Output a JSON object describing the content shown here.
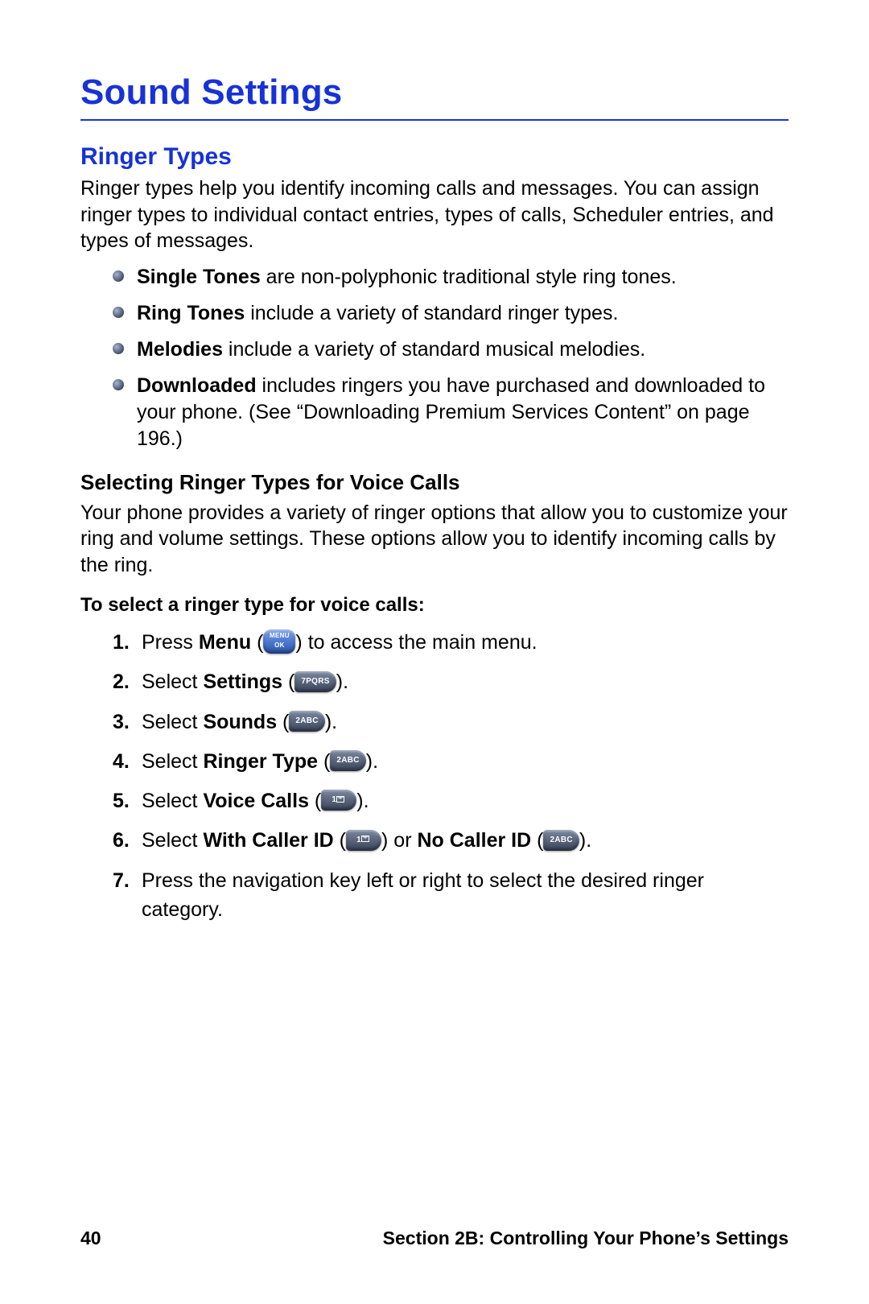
{
  "page_title": "Sound Settings",
  "subhead": "Ringer Types",
  "intro": "Ringer types help you identify incoming calls and messages. You can assign ringer types to individual contact entries, types of calls, Scheduler entries, and types of messages.",
  "bullets": [
    {
      "term": "Single Tones",
      "rest": " are non-polyphonic traditional style ring tones."
    },
    {
      "term": "Ring Tones",
      "rest": " include a variety of standard ringer types."
    },
    {
      "term": "Melodies",
      "rest": " include a variety of standard musical melodies."
    },
    {
      "term": "Downloaded",
      "rest": " includes ringers you have purchased and downloaded to your phone. (See “Downloading Premium Services Content” on page 196.)"
    }
  ],
  "subsub": "Selecting Ringer Types for Voice Calls",
  "subsub_intro": "Your phone provides a variety of ringer options that allow you to customize your ring and volume settings. These options allow you to identify incoming calls by the ring.",
  "lead_in": "To select a ringer type for voice calls:",
  "steps": {
    "s1_pre": "Press ",
    "s1_bold": "Menu",
    "s1_post": " to access the main menu.",
    "s2_pre": "Select ",
    "s2_bold": "Settings",
    "s3_pre": "Select ",
    "s3_bold": "Sounds",
    "s4_pre": "Select ",
    "s4_bold": "Ringer Type",
    "s5_pre": "Select ",
    "s5_bold": "Voice Calls",
    "s6_pre": "Select ",
    "s6_bold1": "With Caller ID",
    "s6_mid": " or ",
    "s6_bold2": "No Caller ID",
    "s7": "Press the navigation key left or right to select the desired ringer category."
  },
  "keys": {
    "menu_l1": "MENU",
    "menu_l2": "OK",
    "k7": "7PQRS",
    "k2": "2ABC",
    "k1": "1"
  },
  "footer": {
    "page_no": "40",
    "section": "Section 2B: Controlling Your Phone’s Settings"
  }
}
